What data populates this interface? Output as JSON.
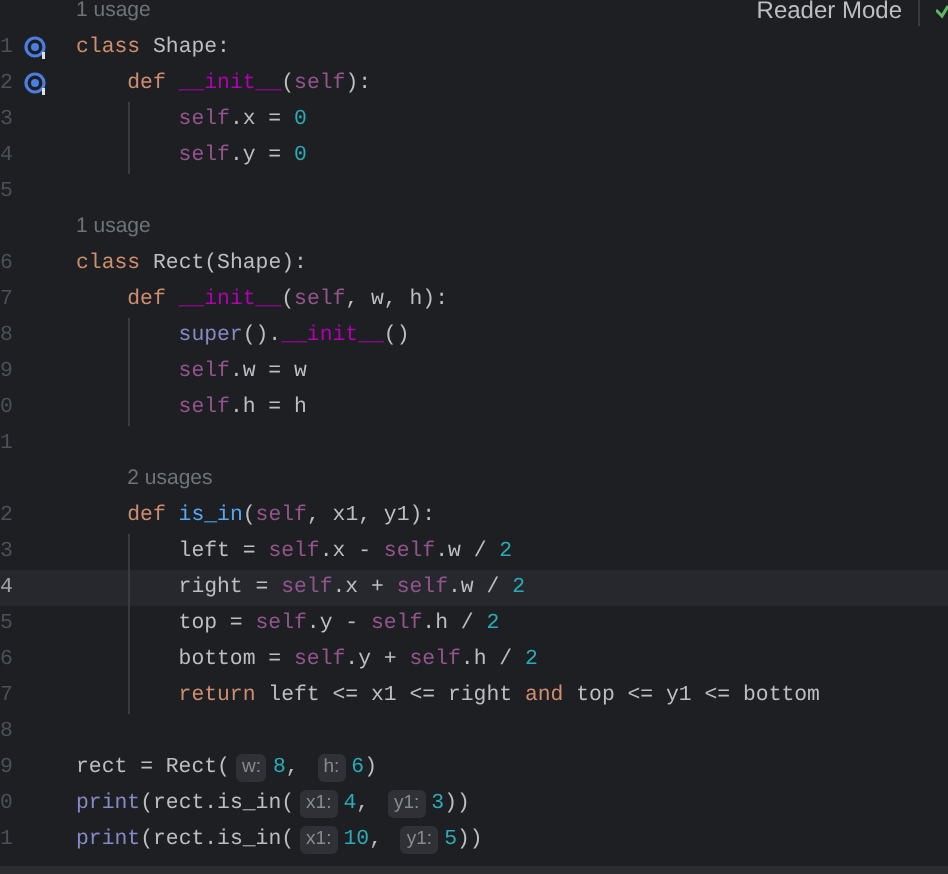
{
  "toolbar": {
    "reader_mode": "Reader Mode"
  },
  "lines": [
    {
      "kind": "usage",
      "text": "1 usage"
    },
    {
      "kind": "code",
      "number": "1",
      "override_marker": true,
      "current": false,
      "tokens": [
        {
          "kind": "kw",
          "text": "class"
        },
        {
          "kind": "plain",
          "text": " Shape:"
        }
      ],
      "children": [
        {
          "kind": "code",
          "number": "2",
          "override_marker": true,
          "current": false,
          "tokens": [
            {
              "kind": "kw",
              "text": "def "
            },
            {
              "kind": "dunder",
              "text": "__init__"
            },
            {
              "kind": "plain",
              "text": "("
            },
            {
              "kind": "self",
              "text": "self"
            },
            {
              "kind": "plain",
              "text": "):"
            }
          ],
          "children": [
            {
              "kind": "code",
              "number": "3",
              "override_marker": false,
              "current": false,
              "tokens": [
                {
                  "kind": "self",
                  "text": "self"
                },
                {
                  "kind": "plain",
                  "text": ".x = "
                },
                {
                  "kind": "num",
                  "text": "0"
                }
              ]
            },
            {
              "kind": "code",
              "number": "4",
              "override_marker": false,
              "current": false,
              "tokens": [
                {
                  "kind": "self",
                  "text": "self"
                },
                {
                  "kind": "plain",
                  "text": ".y = "
                },
                {
                  "kind": "num",
                  "text": "0"
                }
              ]
            }
          ]
        }
      ]
    },
    {
      "kind": "code",
      "number": "5",
      "override_marker": false,
      "current": false
    },
    {
      "kind": "usage",
      "text": "1 usage"
    },
    {
      "kind": "code",
      "number": "6",
      "override_marker": false,
      "current": false,
      "tokens": [
        {
          "kind": "kw",
          "text": "class"
        },
        {
          "kind": "plain",
          "text": " Rect(Shape):"
        }
      ],
      "children": [
        {
          "kind": "code",
          "number": "7",
          "override_marker": false,
          "current": false,
          "tokens": [
            {
              "kind": "kw",
              "text": "def "
            },
            {
              "kind": "dunder",
              "text": "__init__"
            },
            {
              "kind": "plain",
              "text": "("
            },
            {
              "kind": "self",
              "text": "self"
            },
            {
              "kind": "plain",
              "text": ", w, h):"
            }
          ],
          "children": [
            {
              "kind": "code",
              "number": "8",
              "override_marker": false,
              "current": false,
              "tokens": [
                {
                  "kind": "builtin",
                  "text": "super"
                },
                {
                  "kind": "plain",
                  "text": "()."
                },
                {
                  "kind": "dunder",
                  "text": "__init__"
                },
                {
                  "kind": "plain",
                  "text": "()"
                }
              ]
            },
            {
              "kind": "code",
              "number": "9",
              "override_marker": false,
              "current": false,
              "tokens": [
                {
                  "kind": "self",
                  "text": "self"
                },
                {
                  "kind": "plain",
                  "text": ".w = w"
                }
              ]
            },
            {
              "kind": "code",
              "number": "0",
              "override_marker": false,
              "current": false,
              "tokens": [
                {
                  "kind": "self",
                  "text": "self"
                },
                {
                  "kind": "plain",
                  "text": ".h = h"
                }
              ]
            }
          ]
        },
        {
          "kind": "code",
          "number": "1",
          "override_marker": false,
          "current": false
        },
        {
          "kind": "usage",
          "text": "2 usages"
        },
        {
          "kind": "code",
          "number": "2",
          "override_marker": false,
          "current": false,
          "tokens": [
            {
              "kind": "kw",
              "text": "def "
            },
            {
              "kind": "func",
              "text": "is_in"
            },
            {
              "kind": "plain",
              "text": "("
            },
            {
              "kind": "self",
              "text": "self"
            },
            {
              "kind": "plain",
              "text": ", x1, y1):"
            }
          ],
          "children": [
            {
              "kind": "code",
              "number": "3",
              "override_marker": false,
              "current": false,
              "tokens": [
                {
                  "kind": "plain",
                  "text": "left = "
                },
                {
                  "kind": "self",
                  "text": "self"
                },
                {
                  "kind": "plain",
                  "text": ".x - "
                },
                {
                  "kind": "self",
                  "text": "self"
                },
                {
                  "kind": "plain",
                  "text": ".w / "
                },
                {
                  "kind": "num",
                  "text": "2"
                }
              ]
            },
            {
              "kind": "code",
              "number": "4",
              "override_marker": false,
              "current": true,
              "tokens": [
                {
                  "kind": "plain",
                  "text": "right = "
                },
                {
                  "kind": "self",
                  "text": "self"
                },
                {
                  "kind": "plain",
                  "text": ".x + "
                },
                {
                  "kind": "self",
                  "text": "self"
                },
                {
                  "kind": "plain",
                  "text": ".w / "
                },
                {
                  "kind": "num",
                  "text": "2"
                }
              ]
            },
            {
              "kind": "code",
              "number": "5",
              "override_marker": false,
              "current": false,
              "tokens": [
                {
                  "kind": "plain",
                  "text": "top = "
                },
                {
                  "kind": "self",
                  "text": "self"
                },
                {
                  "kind": "plain",
                  "text": ".y - "
                },
                {
                  "kind": "self",
                  "text": "self"
                },
                {
                  "kind": "plain",
                  "text": ".h / "
                },
                {
                  "kind": "num",
                  "text": "2"
                }
              ]
            },
            {
              "kind": "code",
              "number": "6",
              "override_marker": false,
              "current": false,
              "tokens": [
                {
                  "kind": "plain",
                  "text": "bottom = "
                },
                {
                  "kind": "self",
                  "text": "self"
                },
                {
                  "kind": "plain",
                  "text": ".y + "
                },
                {
                  "kind": "self",
                  "text": "self"
                },
                {
                  "kind": "plain",
                  "text": ".h / "
                },
                {
                  "kind": "num",
                  "text": "2"
                }
              ]
            },
            {
              "kind": "code",
              "number": "7",
              "override_marker": false,
              "current": false,
              "tokens": [
                {
                  "kind": "kw",
                  "text": "return"
                },
                {
                  "kind": "plain",
                  "text": " left <= x1 <= right "
                },
                {
                  "kind": "kw",
                  "text": "and"
                },
                {
                  "kind": "plain",
                  "text": " top <= y1 <= bottom"
                }
              ]
            }
          ]
        }
      ]
    },
    {
      "kind": "code",
      "number": "8",
      "override_marker": false,
      "current": false
    },
    {
      "kind": "code",
      "number": "9",
      "override_marker": false,
      "current": false,
      "tokens": [
        {
          "kind": "plain",
          "text": "rect = Rect("
        },
        {
          "kind": "hint",
          "text": "w:"
        },
        {
          "kind": "num",
          "text": "8"
        },
        {
          "kind": "plain",
          "text": ", "
        },
        {
          "kind": "hint",
          "text": "h:"
        },
        {
          "kind": "num",
          "text": "6"
        },
        {
          "kind": "plain",
          "text": ")"
        }
      ]
    },
    {
      "kind": "code",
      "number": "0",
      "override_marker": false,
      "current": false,
      "tokens": [
        {
          "kind": "builtin",
          "text": "print"
        },
        {
          "kind": "plain",
          "text": "(rect.is_in("
        },
        {
          "kind": "hint",
          "text": "x1:"
        },
        {
          "kind": "num",
          "text": "4"
        },
        {
          "kind": "plain",
          "text": ", "
        },
        {
          "kind": "hint",
          "text": "y1:"
        },
        {
          "kind": "num",
          "text": "3"
        },
        {
          "kind": "plain",
          "text": "))"
        }
      ]
    },
    {
      "kind": "code",
      "number": "1",
      "override_marker": false,
      "current": false,
      "tokens": [
        {
          "kind": "builtin",
          "text": "print"
        },
        {
          "kind": "plain",
          "text": "(rect.is_in("
        },
        {
          "kind": "hint",
          "text": "x1:"
        },
        {
          "kind": "num",
          "text": "10"
        },
        {
          "kind": "plain",
          "text": ", "
        },
        {
          "kind": "hint",
          "text": "y1:"
        },
        {
          "kind": "num",
          "text": "5"
        },
        {
          "kind": "plain",
          "text": "))"
        }
      ]
    }
  ]
}
